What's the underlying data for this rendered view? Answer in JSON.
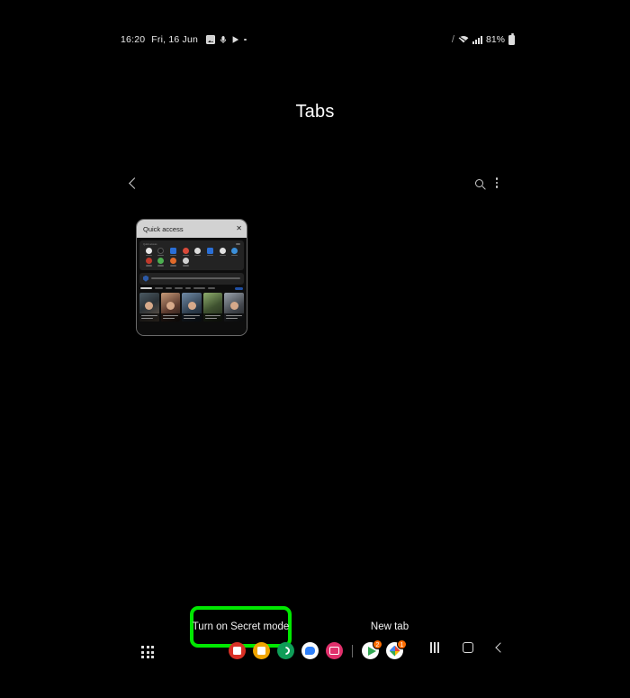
{
  "status_bar": {
    "time": "16:20",
    "date": "Fri, 16 Jun",
    "left_icons": [
      "photo-icon",
      "recording-icon",
      "play-icon",
      "dot-icon"
    ],
    "right_icons": [
      "slash-icon",
      "wifi-icon",
      "signal-icon"
    ],
    "battery_percent": "81%",
    "battery_icon": "battery-icon"
  },
  "header": {
    "title": "Tabs"
  },
  "actions": {
    "back_icon": "chevron-left-icon",
    "search_icon": "search-icon",
    "menu_icon": "more-vertical-icon"
  },
  "tab_card": {
    "title": "Quick access",
    "close_label": "✕",
    "quick_access_label": "Quick access",
    "more_label": "",
    "section_label": "",
    "shortcuts": [
      {
        "name": "Gmail",
        "color": "#e8e8e8"
      },
      {
        "name": "Bing",
        "color": "#1a1a1a"
      },
      {
        "name": "Store",
        "color": "#2a6fd6"
      },
      {
        "name": "News",
        "color": "#d84a3a"
      },
      {
        "name": "Drive",
        "color": "#dcdcdc"
      },
      {
        "name": "Maps",
        "color": "#2a6fd6"
      },
      {
        "name": "Docs",
        "color": "#e2e2e2"
      },
      {
        "name": "TV",
        "color": "#3b8fd9"
      },
      {
        "name": "Netflix",
        "color": "#c0392b"
      },
      {
        "name": "Spotify",
        "color": "#4caf50"
      },
      {
        "name": "Reddit",
        "color": "#e06a2a"
      },
      {
        "name": "More",
        "color": "#cfcfcf"
      }
    ],
    "notice": {
      "icon": "shield-icon",
      "text": ""
    },
    "categories": [
      "For you",
      "Top news",
      "Latest",
      "Politics",
      "Tech",
      "Entertainment",
      "Sports",
      "Business"
    ],
    "news": [
      {
        "thumb": "thumb-a"
      },
      {
        "thumb": "thumb-b"
      },
      {
        "thumb": "thumb-c"
      },
      {
        "thumb": "thumb-d"
      },
      {
        "thumb": "thumb-e"
      }
    ]
  },
  "bottom_actions": {
    "secret_mode_label": "Turn on Secret mode",
    "new_tab_label": "New tab",
    "highlight_color": "#00e800"
  },
  "taskbar": {
    "apps_grid_icon": "apps-grid-icon",
    "apps": [
      {
        "name": "gmail-app-icon",
        "badge": ""
      },
      {
        "name": "notes-app-icon",
        "badge": ""
      },
      {
        "name": "phone-app-icon",
        "badge": ""
      },
      {
        "name": "messages-app-icon",
        "badge": ""
      },
      {
        "name": "instagram-app-icon",
        "badge": ""
      },
      {
        "name": "play-store-app-icon",
        "badge": "2"
      },
      {
        "name": "photos-app-icon",
        "badge": "1"
      }
    ],
    "nav": {
      "recents_icon": "recents-icon",
      "home_icon": "home-icon",
      "back_icon": "back-icon"
    }
  }
}
